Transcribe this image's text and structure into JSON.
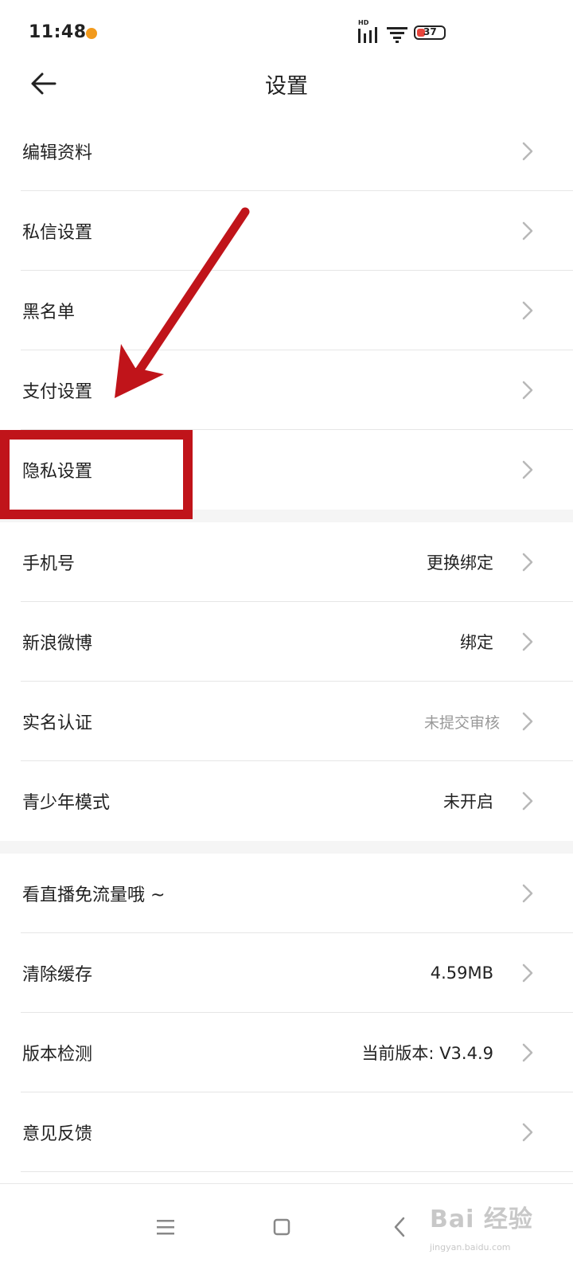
{
  "status_bar": {
    "time": "11:48",
    "hd_label": "HD",
    "battery_level": "37",
    "dot_color": "#f29a1c"
  },
  "header": {
    "title": "设置"
  },
  "groups": [
    {
      "items": [
        {
          "label": "编辑资料",
          "value": ""
        },
        {
          "label": "私信设置",
          "value": ""
        },
        {
          "label": "黑名单",
          "value": ""
        },
        {
          "label": "支付设置",
          "value": ""
        },
        {
          "label": "隐私设置",
          "value": ""
        }
      ]
    },
    {
      "items": [
        {
          "label": "手机号",
          "value": "更换绑定"
        },
        {
          "label": "新浪微博",
          "value": "绑定"
        },
        {
          "label": "实名认证",
          "value": "未提交审核"
        },
        {
          "label": "青少年模式",
          "value": "未开启"
        }
      ]
    },
    {
      "items": [
        {
          "label": "看直播免流量哦 ~",
          "value": ""
        },
        {
          "label": "清除缓存",
          "value": "4.59MB"
        },
        {
          "label": "版本检测",
          "value": "当前版本: V3.4.9"
        },
        {
          "label": "意见反馈",
          "value": ""
        }
      ]
    }
  ],
  "watermark": {
    "text": "Bai 经验",
    "sub": "jingyan.baidu.com"
  },
  "colors": {
    "annotation_red": "#c0141a",
    "chevron": "#b8b8b8",
    "muted_value": "#999999"
  }
}
